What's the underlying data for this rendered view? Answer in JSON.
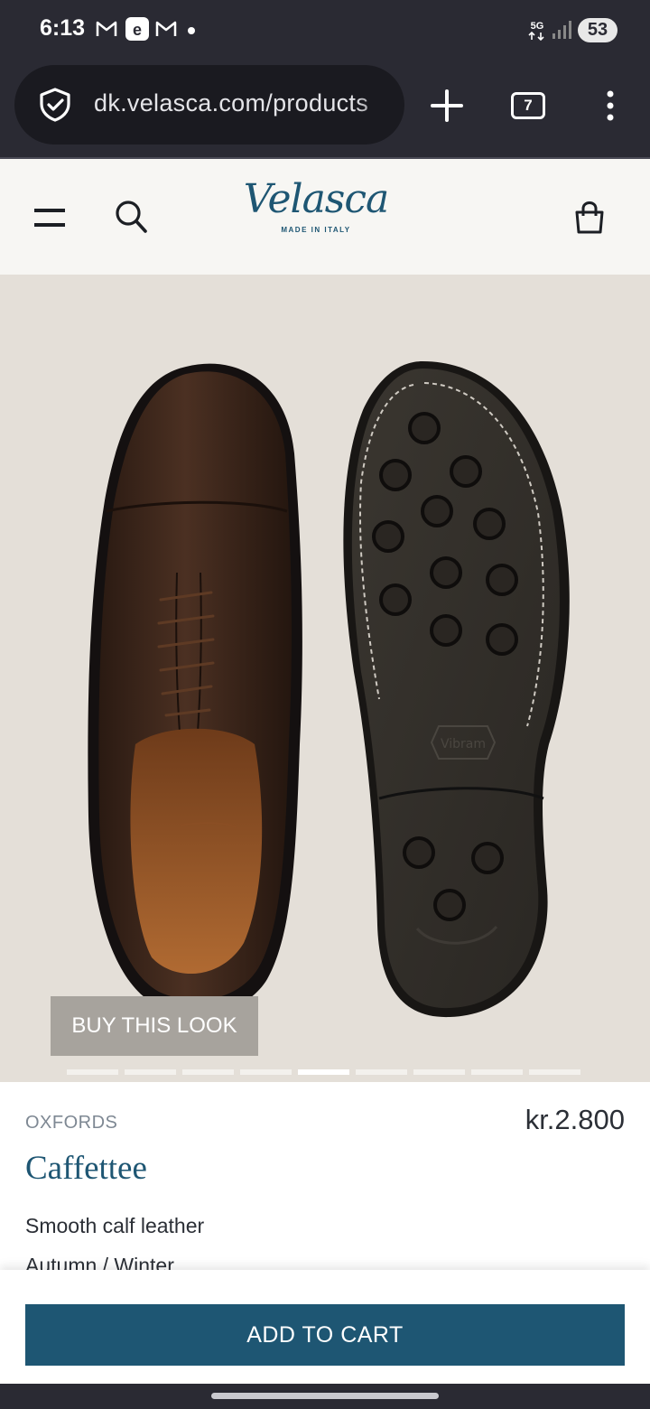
{
  "status_bar": {
    "time": "6:13",
    "network": "5G",
    "battery": "53",
    "notification_icons": [
      "gmail-icon",
      "email-app-icon",
      "gmail-icon"
    ]
  },
  "browser": {
    "url": "dk.velasca.com/products",
    "tab_count": "7"
  },
  "site_header": {
    "logo_text": "Velasca",
    "logo_tagline": "MADE IN ITALY"
  },
  "gallery": {
    "buy_look_label": "BUY THIS LOOK",
    "image_count": 9,
    "active_index": 4,
    "sole_brand": "Vibram"
  },
  "product": {
    "category": "OXFORDS",
    "name": "Caffettee",
    "price": "kr.2.800",
    "material": "Smooth calf leather",
    "season": "Autumn / Winter"
  },
  "cart": {
    "add_to_cart_label": "ADD TO CART"
  },
  "colors": {
    "brand": "#1e5673",
    "system_bar": "#2a2a33",
    "backdrop": "#e4dfd8"
  }
}
